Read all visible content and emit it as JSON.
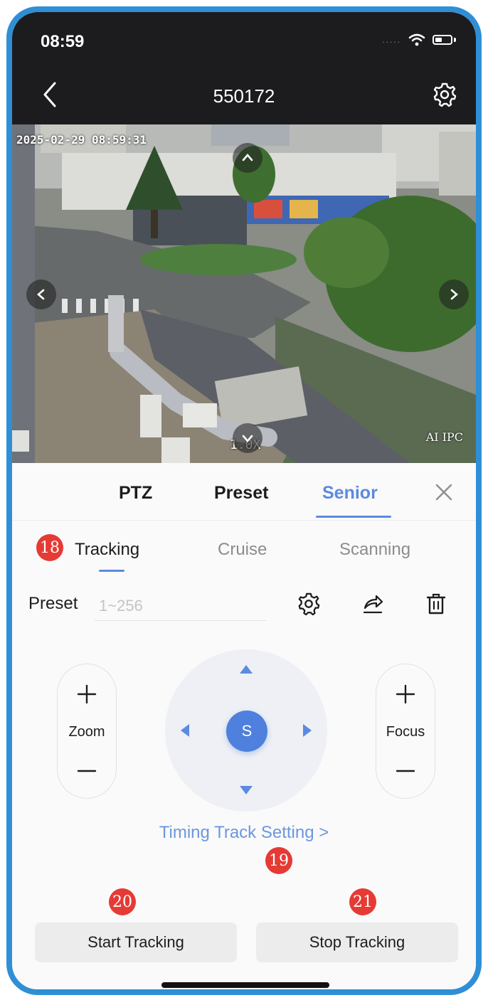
{
  "status_bar": {
    "time": "08:59",
    "signal": "....."
  },
  "header": {
    "title": "550172"
  },
  "camera": {
    "timestamp": "2025-02-29 08:59:31",
    "zoom": "1.0X",
    "brand": "AI IPC"
  },
  "tabs": [
    {
      "label": "PTZ",
      "active": false
    },
    {
      "label": "Preset",
      "active": false
    },
    {
      "label": "Senior",
      "active": true
    }
  ],
  "subtabs": [
    {
      "label": "Tracking",
      "active": true
    },
    {
      "label": "Cruise",
      "active": false
    },
    {
      "label": "Scanning",
      "active": false
    }
  ],
  "preset": {
    "label": "Preset",
    "placeholder": "1~256",
    "value": ""
  },
  "controls": {
    "zoom_label": "Zoom",
    "focus_label": "Focus",
    "center_label": "S"
  },
  "timing_link": "Timing Track Setting >",
  "buttons": {
    "start": "Start Tracking",
    "stop": "Stop Tracking"
  },
  "badges": {
    "b18": "18",
    "b19": "19",
    "b20": "20",
    "b21": "21"
  },
  "colors": {
    "accent": "#5b8ae0",
    "badge": "#e63a35",
    "frame": "#2e8fd6",
    "header_bg": "#1c1c1e"
  }
}
